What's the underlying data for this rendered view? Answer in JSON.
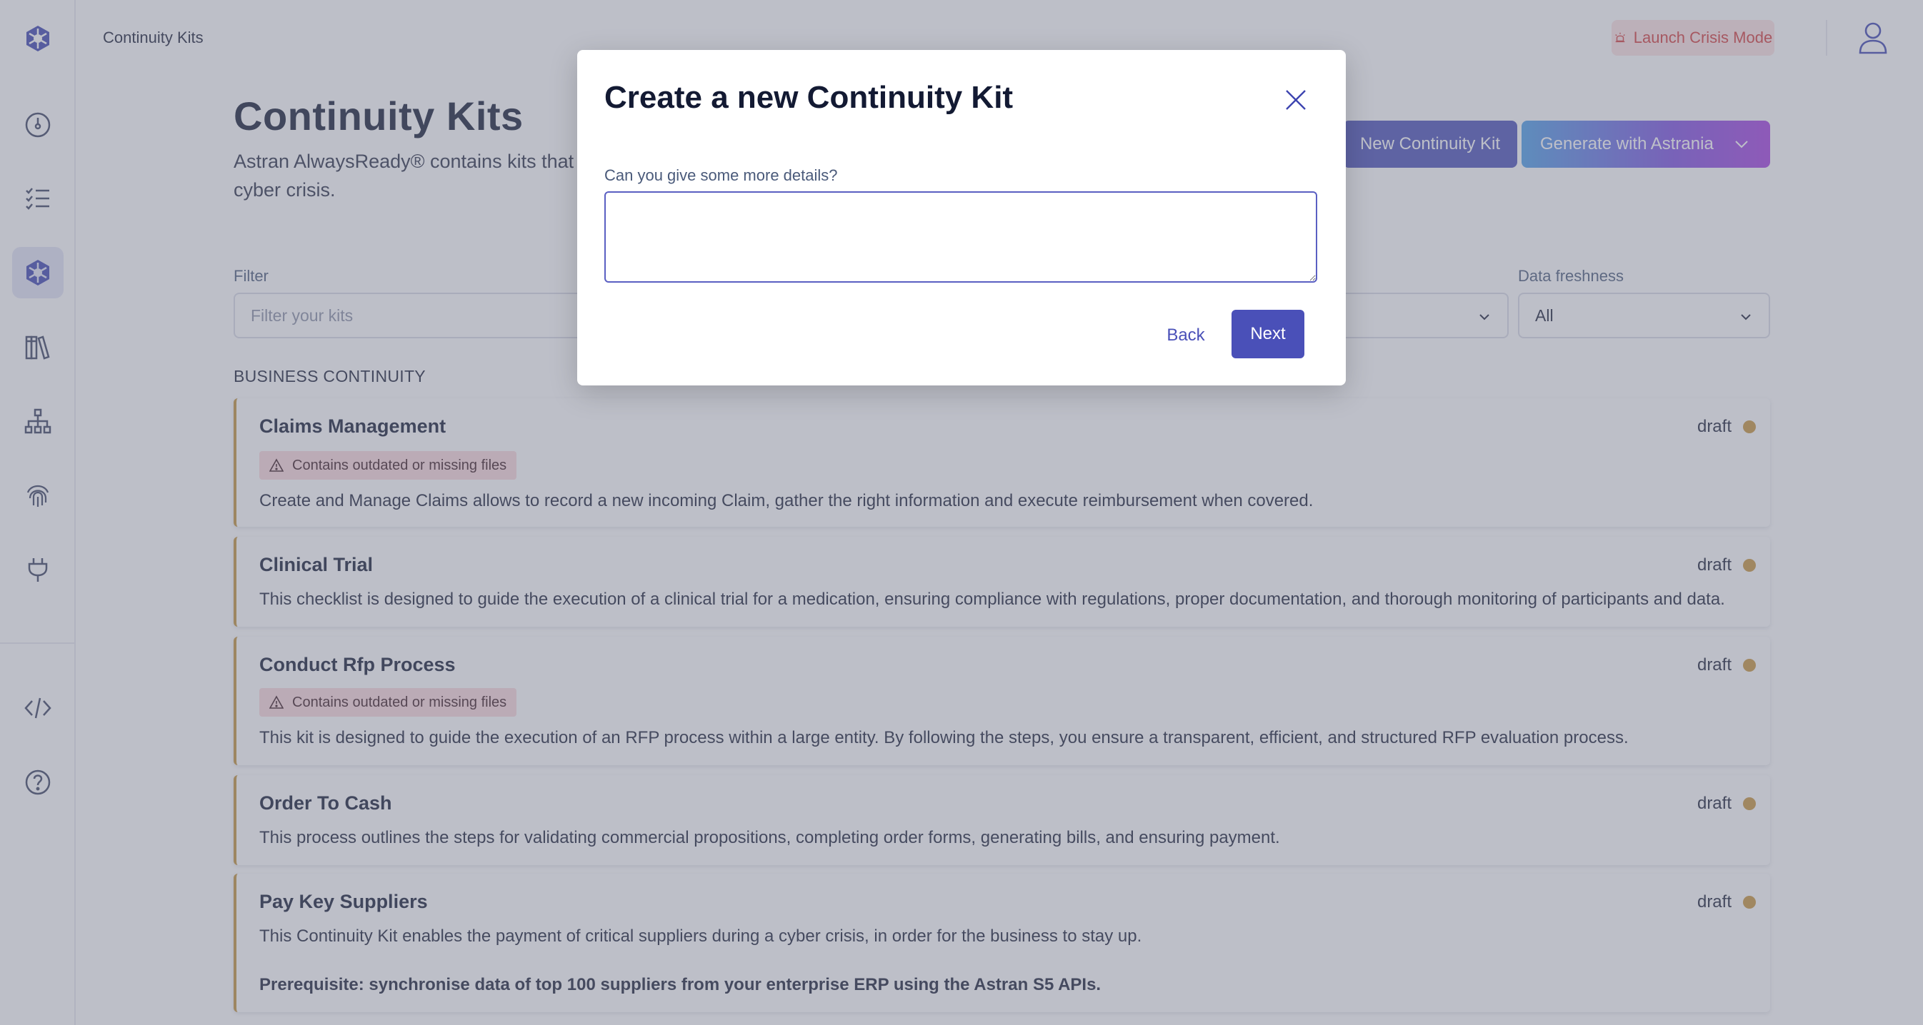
{
  "app": {
    "breadcrumb": "Continuity Kits"
  },
  "header": {
    "crisis_label": "Launch Crisis Mode"
  },
  "sidebar": {
    "items": [
      {
        "name": "logo",
        "icon": "hexagon-logo-icon"
      },
      {
        "name": "dashboard",
        "icon": "gauge-icon"
      },
      {
        "name": "checklists",
        "icon": "checklist-icon"
      },
      {
        "name": "continuity-kits",
        "icon": "hexagon-logo-icon",
        "active": true
      },
      {
        "name": "library",
        "icon": "books-icon"
      },
      {
        "name": "organization",
        "icon": "org-chart-icon"
      },
      {
        "name": "fingerprint",
        "icon": "fingerprint-icon"
      },
      {
        "name": "integrations",
        "icon": "plug-icon"
      },
      {
        "name": "api",
        "icon": "code-icon"
      },
      {
        "name": "help",
        "icon": "question-icon"
      }
    ]
  },
  "main": {
    "title": "Continuity Kits",
    "description": "Astran AlwaysReady® contains kits that provide procedures and checklists to execute during a cyber crisis.",
    "new_kit_label": "New Continuity Kit",
    "generate_label": "Generate with Astrania"
  },
  "filters": {
    "filter_label": "Filter",
    "filter_placeholder": "Filter your kits",
    "freshness_label": "Data freshness",
    "freshness_value": "All"
  },
  "section_title": "BUSINESS CONTINUITY",
  "cards": [
    {
      "title": "Claims Management",
      "status": "draft",
      "warning": "Contains outdated or missing files",
      "description": "Create and Manage Claims allows to record a new incoming Claim, gather the right information and execute reimbursement when covered."
    },
    {
      "title": "Clinical Trial",
      "status": "draft",
      "description": "This checklist is designed to guide the execution of a clinical trial for a medication, ensuring compliance with regulations, proper documentation, and thorough monitoring of participants and data."
    },
    {
      "title": "Conduct Rfp Process",
      "status": "draft",
      "warning": "Contains outdated or missing files",
      "description": "This kit is designed to guide the execution of an RFP process within a large entity. By following the steps, you ensure a transparent, efficient, and structured RFP evaluation process."
    },
    {
      "title": "Order To Cash",
      "status": "draft",
      "description": "This process outlines the steps for validating commercial propositions, completing order forms, generating bills, and ensuring payment."
    },
    {
      "title": "Pay Key Suppliers",
      "status": "draft",
      "description": "This Continuity Kit enables the payment of critical suppliers during a cyber crisis, in order for the business to stay up.",
      "extra": "Prerequisite: synchronise data of top 100 suppliers from your enterprise ERP using the Astran S5 APIs."
    }
  ],
  "modal": {
    "title": "Create a new Continuity Kit",
    "question": "Can you give some more details?",
    "textarea_value": "",
    "back_label": "Back",
    "next_label": "Next"
  },
  "colors": {
    "accent": "#4a50b8",
    "draft_dot": "#c8953a",
    "warning_bg": "#fbd9dc",
    "crisis_text": "#d33a3a"
  }
}
